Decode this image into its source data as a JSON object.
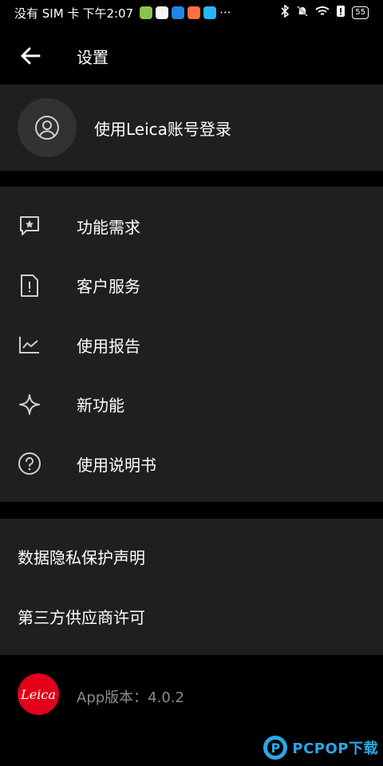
{
  "status_bar": {
    "carrier": "没有 SIM 卡",
    "time": "下午2:07",
    "more": "···",
    "battery": "55",
    "app_icons": [
      {
        "name": "app-icon",
        "color": "#8bc34a"
      },
      {
        "name": "app-icon",
        "color": "#f5f5f5"
      },
      {
        "name": "app-icon",
        "color": "#1e88e5"
      },
      {
        "name": "app-icon",
        "color": "#ff7043"
      },
      {
        "name": "app-icon",
        "color": "#29b6f6"
      }
    ]
  },
  "header": {
    "title": "设置"
  },
  "login": {
    "label": "使用Leica账号登录"
  },
  "menu1": {
    "items": [
      {
        "label": "功能需求",
        "icon": "feature-request-icon"
      },
      {
        "label": "客户服务",
        "icon": "customer-service-icon"
      },
      {
        "label": "使用报告",
        "icon": "usage-report-icon"
      },
      {
        "label": "新功能",
        "icon": "new-feature-icon"
      },
      {
        "label": "使用说明书",
        "icon": "help-icon"
      }
    ]
  },
  "menu2": {
    "items": [
      {
        "label": "数据隐私保护声明"
      },
      {
        "label": "第三方供应商许可"
      }
    ]
  },
  "footer": {
    "logo_text": "Leica",
    "version": "App版本：4.0.2",
    "brand_color": "#e2001a"
  },
  "watermark": {
    "text": "PCPOP下载",
    "color": "#2aa7e6"
  }
}
